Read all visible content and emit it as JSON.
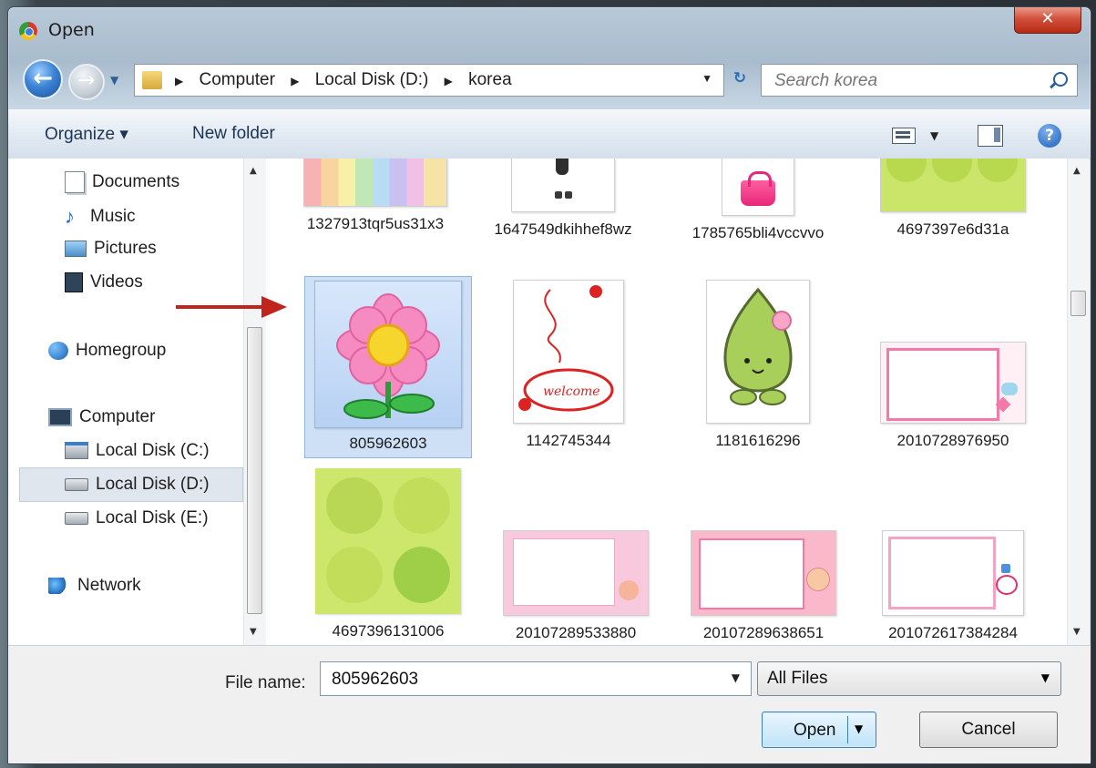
{
  "window": {
    "title": "Open",
    "close_label": "✕"
  },
  "address_bar": {
    "crumbs": [
      "Computer",
      "Local Disk (D:)",
      "korea"
    ],
    "search_placeholder": "Search korea"
  },
  "toolbar": {
    "organize_label": "Organize ▾",
    "new_folder_label": "New folder"
  },
  "nav_pane": {
    "items": [
      {
        "label": "Documents",
        "icon": "documents-icon"
      },
      {
        "label": "Music",
        "icon": "music-icon"
      },
      {
        "label": "Pictures",
        "icon": "pictures-icon"
      },
      {
        "label": "Videos",
        "icon": "videos-icon"
      },
      {
        "label": "Homegroup",
        "icon": "homegroup-icon"
      },
      {
        "label": "Computer",
        "icon": "computer-icon"
      },
      {
        "label": "Local Disk (C:)",
        "icon": "drive-c-icon"
      },
      {
        "label": "Local Disk (D:)",
        "icon": "drive-icon",
        "selected": true
      },
      {
        "label": "Local Disk (E:)",
        "icon": "drive-icon"
      },
      {
        "label": "Network",
        "icon": "network-icon"
      }
    ]
  },
  "files": [
    {
      "name": "1327913tqr5us31x3"
    },
    {
      "name": "1647549dkihhef8wz"
    },
    {
      "name": "1785765bli4vccvvo"
    },
    {
      "name": "4697397e6d31a"
    },
    {
      "name": "805962603",
      "selected": true
    },
    {
      "name": "1142745344"
    },
    {
      "name": "1181616296"
    },
    {
      "name": "2010728976950"
    },
    {
      "name": "4697396131006"
    },
    {
      "name": "20107289533880"
    },
    {
      "name": "20107289638651"
    },
    {
      "name": "201072617384284"
    }
  ],
  "footer": {
    "file_name_label": "File name:",
    "file_name_value": "805962603",
    "filter_label": "All Files",
    "open_label": "Open",
    "cancel_label": "Cancel"
  },
  "colors": {
    "selection": "#cde0f6",
    "annotation_arrow": "#c0241c"
  }
}
